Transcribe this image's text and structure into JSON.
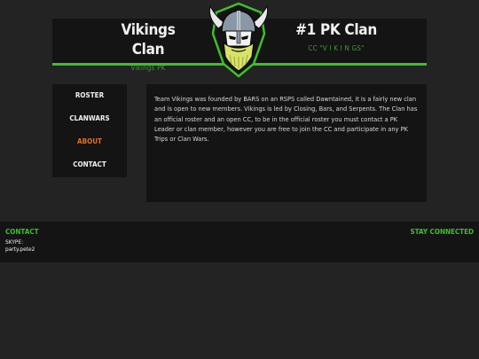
{
  "header": {
    "left_title": "Vikings Clan",
    "left_subtitle": "Vikings PK",
    "right_title": "#1 PK Clan",
    "right_subtitle": "CC \"V I K I N GS\""
  },
  "logo": {
    "icon": "viking-helmet-logo"
  },
  "nav": {
    "items": [
      {
        "label": "ROSTER"
      },
      {
        "label": "CLANWARS"
      },
      {
        "label": "ABOUT",
        "active": true
      },
      {
        "label": "CONTACT"
      }
    ]
  },
  "about": {
    "text": "Team Vikings was founded by BARS on an RSPS called Dawntained, it is a fairly new clan and is open to new members. Vikings is led by Closing, Bars, and Serpents. The Clan has an official roster and an open CC, to be in the official roster you must contact a PK Leader or clan member, however you are free to join the CC and participate in any PK Trips or Clan Wars."
  },
  "footer": {
    "contact_heading": "CONTACT",
    "skype_label": "SKYPE:",
    "skype_value": "party.pete2",
    "stay_connected": "STAY CONNECTED"
  },
  "colors": {
    "accent_green": "#3fbf2e",
    "active_orange": "#e0701f",
    "panel": "#141414",
    "background": "#232323"
  }
}
